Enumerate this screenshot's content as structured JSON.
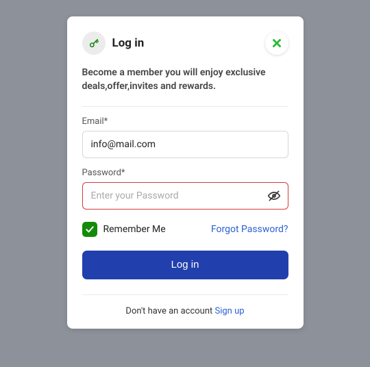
{
  "header": {
    "title": "Log in",
    "key_icon": "key-icon",
    "close_icon": "close-icon"
  },
  "subtitle": "Become a member you will enjoy exclusive deals,offer,invites and rewards.",
  "form": {
    "email": {
      "label": "Email*",
      "value": "info@mail.com",
      "placeholder": ""
    },
    "password": {
      "label": "Password*",
      "value": "",
      "placeholder": "Enter your Password"
    },
    "remember_label": "Remember Me",
    "remember_checked": true,
    "forgot": "Forgot Password?",
    "submit": "Log in"
  },
  "footer": {
    "prefix": "Don't have an account ",
    "signup": "Sign up"
  },
  "colors": {
    "accent": "#213fad",
    "success": "#148a0b",
    "close": "#2fb93a",
    "error_border": "#d43a3a",
    "link": "#2a5fd2"
  }
}
